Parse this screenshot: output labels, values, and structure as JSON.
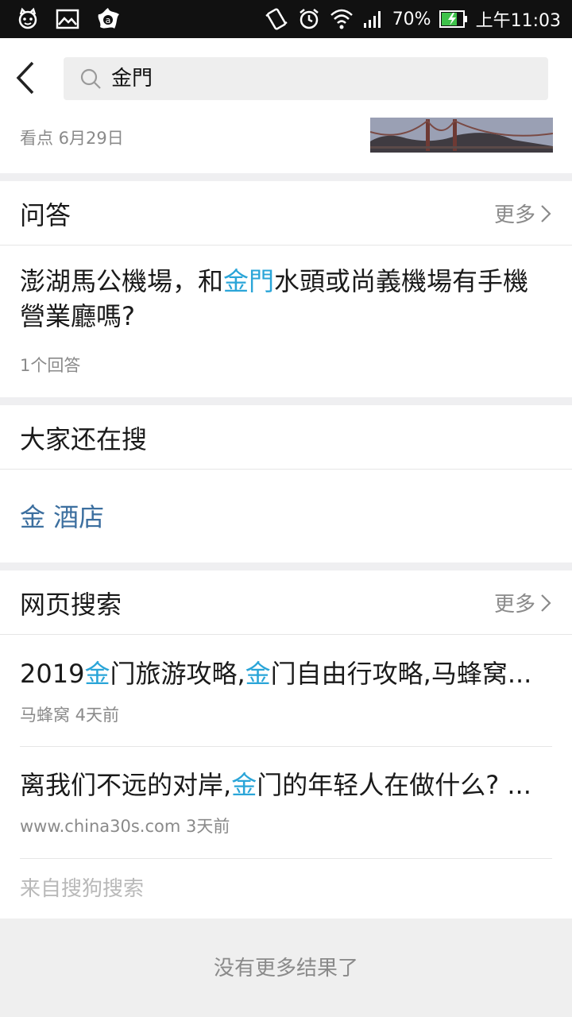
{
  "status_bar": {
    "battery_percent": "70%",
    "time": "上午11:03",
    "icons": [
      "cat-icon",
      "image-icon",
      "avast-icon",
      "vibrate-icon",
      "alarm-icon",
      "wifi-icon",
      "signal-icon",
      "battery-charging-icon"
    ]
  },
  "search": {
    "query": "金門"
  },
  "topic": {
    "meta": "看点 6月29日"
  },
  "qa": {
    "title": "问答",
    "more_label": "更多",
    "question_parts": [
      "澎湖馬公機場，和",
      "金門",
      "水頭或尚義機場有手機營業廳嗎?"
    ],
    "answers": "1个回答"
  },
  "related": {
    "title": "大家还在搜",
    "term": "金 酒店"
  },
  "web": {
    "title": "网页搜索",
    "more_label": "更多",
    "results": [
      {
        "title_parts": [
          "2019",
          "金",
          "门旅游攻略,",
          "金",
          "门自由行攻略,马蜂窝..."
        ],
        "meta": "马蜂窝 4天前"
      },
      {
        "title_parts": [
          "离我们不远的对岸,",
          "金",
          "门的年轻人在做什么? ..."
        ],
        "meta": "www.china30s.com 3天前"
      }
    ],
    "source_note": "来自搜狗搜索"
  },
  "footer": {
    "text": "没有更多结果了"
  },
  "colors": {
    "highlight": "#2aa5d8",
    "related_link": "#3c6f9f",
    "status_bar": "#111111",
    "section_gap": "#efeff1"
  }
}
